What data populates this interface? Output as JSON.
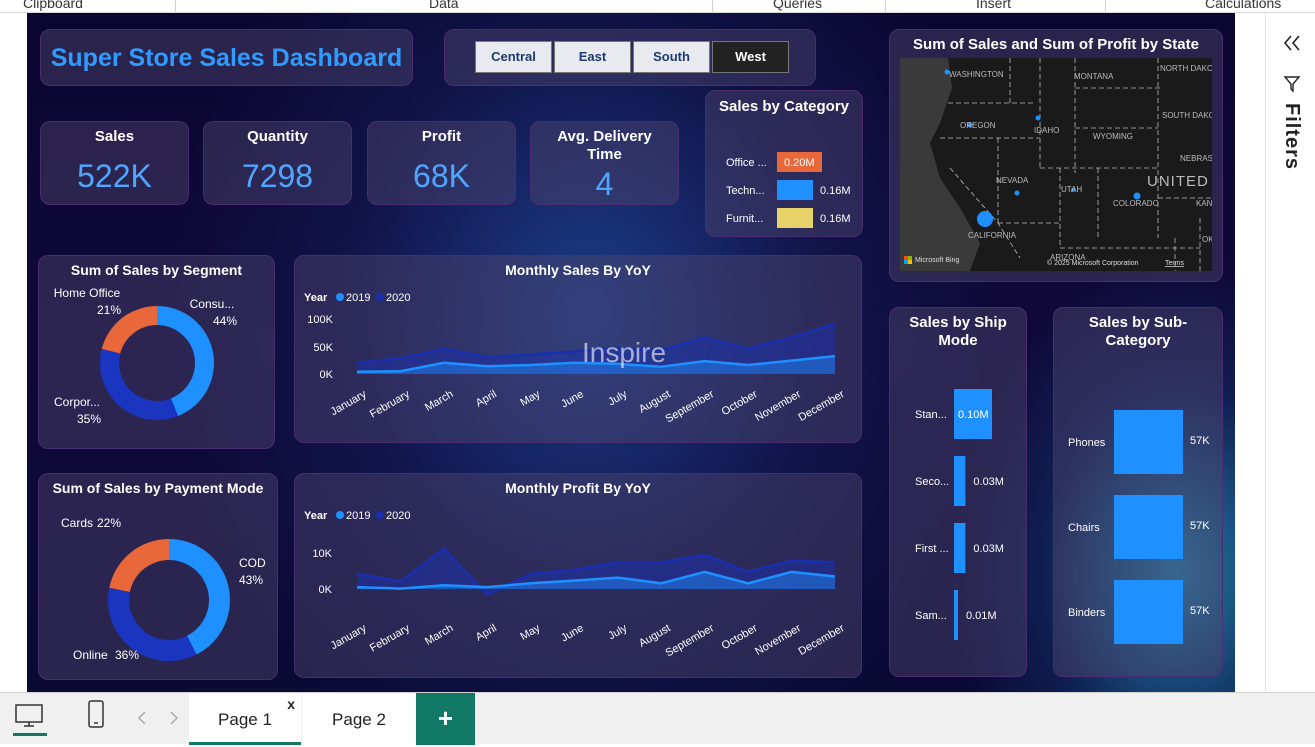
{
  "ribbon": {
    "groups": [
      "Clipboard",
      "Data",
      "Queries",
      "Insert",
      "Calculations"
    ]
  },
  "dashboard": {
    "title": "Super Store Sales Dashboard",
    "regions": [
      "Central",
      "East",
      "South",
      "West"
    ],
    "selected_region": "West",
    "kpis": [
      {
        "label": "Sales",
        "value": "522K"
      },
      {
        "label": "Quantity",
        "value": "7298"
      },
      {
        "label": "Profit",
        "value": "68K"
      },
      {
        "label": "Avg. Delivery Time",
        "value": "4"
      }
    ],
    "watermark": "Inspire"
  },
  "category_chart": {
    "title": "Sales by Category",
    "rows": [
      {
        "label": "Office ...",
        "value": "0.20M",
        "num": 0.2,
        "color": "#e8683a"
      },
      {
        "label": "Techn...",
        "value": "0.16M",
        "num": 0.16,
        "color": "#1e90ff"
      },
      {
        "label": "Furnit...",
        "value": "0.16M",
        "num": 0.16,
        "color": "#e8d36a"
      }
    ]
  },
  "map": {
    "title": "Sum of Sales and Sum of Profit by State",
    "labels": [
      {
        "text": "WASHINGTON",
        "id": "wa"
      },
      {
        "text": "MONTANA",
        "id": "mt"
      },
      {
        "text": "NORTH DAKO",
        "id": "nd"
      },
      {
        "text": "OREGON",
        "id": "or"
      },
      {
        "text": "IDAHO",
        "id": "id"
      },
      {
        "text": "WYOMING",
        "id": "wy"
      },
      {
        "text": "SOUTH DAKO",
        "id": "sd"
      },
      {
        "text": "NEBRAS",
        "id": "ne"
      },
      {
        "text": "NEVADA",
        "id": "nv"
      },
      {
        "text": "UTAH",
        "id": "ut"
      },
      {
        "text": "UNITED",
        "id": "us"
      },
      {
        "text": "COLORADO",
        "id": "co"
      },
      {
        "text": "KAN",
        "id": "ks"
      },
      {
        "text": "CALIFORNIA",
        "id": "ca"
      },
      {
        "text": "OK",
        "id": "ok"
      },
      {
        "text": "ARIZONA",
        "id": "az"
      }
    ],
    "brand": "Microsoft Bing",
    "copyright": "© 2025 Microsoft Corporation",
    "terms": "Terms"
  },
  "segment_chart": {
    "title": "Sum of Sales by Segment",
    "slices": [
      {
        "name": "Consu...",
        "pct": "44%",
        "num": 44,
        "color": "#1e90ff"
      },
      {
        "name": "Corpor...",
        "pct": "35%",
        "num": 35,
        "color": "#1a35c0"
      },
      {
        "name": "Home Office",
        "pct": "21%",
        "num": 21,
        "color": "#e8683a"
      }
    ]
  },
  "payment_chart": {
    "title": "Sum of Sales by Payment Mode",
    "slices": [
      {
        "name": "COD",
        "pct": "43%",
        "num": 43,
        "color": "#1e90ff"
      },
      {
        "name": "Online",
        "pct": "36%",
        "num": 36,
        "color": "#1a35c0"
      },
      {
        "name": "Cards",
        "pct": "22%",
        "num": 22,
        "color": "#e8683a"
      }
    ]
  },
  "chart_data": [
    {
      "type": "area",
      "title": "Monthly Sales By YoY",
      "legend_title": "Year",
      "categories": [
        "January",
        "February",
        "March",
        "April",
        "May",
        "June",
        "July",
        "August",
        "September",
        "October",
        "November",
        "December"
      ],
      "yticks": [
        "100K",
        "50K",
        "0K"
      ],
      "ylim": [
        0,
        100000
      ],
      "series": [
        {
          "name": "2019",
          "color": "#1e90ff",
          "values": [
            4000,
            5000,
            20000,
            14000,
            16000,
            20000,
            18000,
            13000,
            23000,
            16000,
            24000,
            32000
          ]
        },
        {
          "name": "2020",
          "color": "#1a2fb0",
          "values": [
            20000,
            28000,
            45000,
            30000,
            35000,
            40000,
            47000,
            42000,
            65000,
            45000,
            65000,
            90000
          ]
        }
      ]
    },
    {
      "type": "area",
      "title": "Monthly Profit By YoY",
      "legend_title": "Year",
      "categories": [
        "January",
        "February",
        "March",
        "April",
        "May",
        "June",
        "July",
        "August",
        "September",
        "October",
        "November",
        "December"
      ],
      "yticks": [
        "10K",
        "0K"
      ],
      "ylim": [
        0,
        10000
      ],
      "series": [
        {
          "name": "2019",
          "color": "#1e90ff",
          "values": [
            500,
            100,
            1000,
            500,
            1500,
            2200,
            3000,
            1500,
            4500,
            1500,
            4500,
            3300
          ]
        },
        {
          "name": "2020",
          "color": "#1a2fb0",
          "values": [
            4000,
            2000,
            10500,
            -1500,
            4000,
            5000,
            7000,
            7000,
            9000,
            4500,
            7500,
            7000
          ]
        }
      ]
    },
    {
      "type": "bar",
      "title": "Sales by Ship Mode",
      "categories": [
        "Stan...",
        "Seco...",
        "First ...",
        "Sam..."
      ],
      "values": [
        0.1,
        0.03,
        0.03,
        0.01
      ],
      "labels": [
        "0.10M",
        "0.03M",
        "0.03M",
        "0.01M"
      ],
      "unit": "M"
    },
    {
      "type": "bar",
      "title": "Sales by Sub-Category",
      "categories": [
        "Phones",
        "Chairs",
        "Binders"
      ],
      "values": [
        57,
        57,
        57
      ],
      "labels": [
        "57K",
        "57K",
        "57K"
      ],
      "unit": "K"
    }
  ],
  "pages": {
    "tabs": [
      "Page 1",
      "Page 2"
    ],
    "active": "Page 1",
    "close_glyph": "x",
    "add_glyph": "+"
  },
  "filters_pane": {
    "label": "Filters"
  }
}
